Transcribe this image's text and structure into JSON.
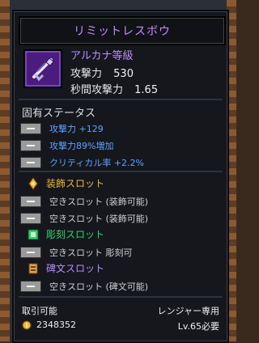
{
  "item": {
    "name": "リミットレスボウ",
    "grade": "アルカナ等級",
    "stats": [
      {
        "label": "攻撃力",
        "value": "530"
      },
      {
        "label": "秒間攻撃力",
        "value": "1.65"
      }
    ]
  },
  "unique_status": {
    "title": "固有ステータス",
    "lines": [
      {
        "text": "攻撃力 +129"
      },
      {
        "text": "攻撃力89%増加"
      },
      {
        "text": "クリティカル率 +2.2%"
      }
    ]
  },
  "slots": {
    "jewel": {
      "title": "装飾スロット",
      "lines": [
        "空きスロット (装飾可能)",
        "空きスロット (装飾可能)"
      ]
    },
    "engrave": {
      "title": "彫刻スロット",
      "lines": [
        "空きスロット 彫刻可"
      ]
    },
    "rune": {
      "title": "碑文スロット",
      "lines": [
        "空きスロット (碑文可能)"
      ]
    }
  },
  "footer": {
    "tradable": "取引可能",
    "class": "レンジャー専用",
    "price": "2348352",
    "level_req": "Lv.65必要"
  },
  "colors": {
    "arcana": "#b98cff",
    "blue_stat": "#5da2ff",
    "jewel": "#f0b53a",
    "engrave": "#2fd36a"
  },
  "icons": {
    "weapon": "bow-icon",
    "jewel": "jewel-slot-icon",
    "engrave": "engrave-slot-icon",
    "rune": "rune-slot-icon",
    "coin": "coin-icon"
  }
}
